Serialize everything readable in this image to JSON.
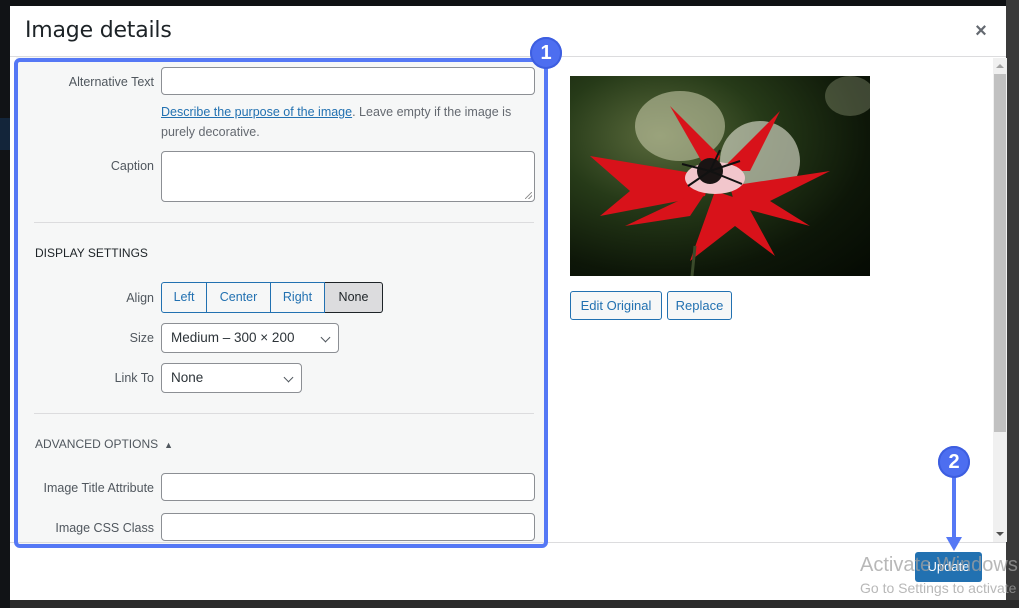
{
  "modal": {
    "title": "Image details",
    "close_label": "×"
  },
  "fields": {
    "alt_text": {
      "label": "Alternative Text",
      "value": ""
    },
    "alt_help_link": "Describe the purpose of the image",
    "alt_help_rest": ". Leave empty if the image is purely decorative.",
    "caption": {
      "label": "Caption",
      "value": ""
    }
  },
  "display_settings": {
    "title": "DISPLAY SETTINGS",
    "align": {
      "label": "Align",
      "options": [
        "Left",
        "Center",
        "Right",
        "None"
      ],
      "selected": "None"
    },
    "size": {
      "label": "Size",
      "value": "Medium – 300 × 200"
    },
    "link_to": {
      "label": "Link To",
      "value": "None"
    }
  },
  "advanced_options": {
    "title": "ADVANCED OPTIONS",
    "toggle_icon": "▲",
    "image_title": {
      "label": "Image Title Attribute",
      "value": ""
    },
    "css_class": {
      "label": "Image CSS Class",
      "value": ""
    }
  },
  "image_actions": {
    "edit_original": "Edit Original",
    "replace": "Replace"
  },
  "footer": {
    "update": "Update"
  },
  "annotations": {
    "badge_1": "1",
    "badge_2": "2",
    "accent_color": "#5578f5"
  },
  "watermark": {
    "line1": "Activate Windows",
    "line2": "Go to Settings to activate Windows."
  },
  "colors": {
    "primary": "#2271b1",
    "pane_bg": "#f6f7f7"
  }
}
